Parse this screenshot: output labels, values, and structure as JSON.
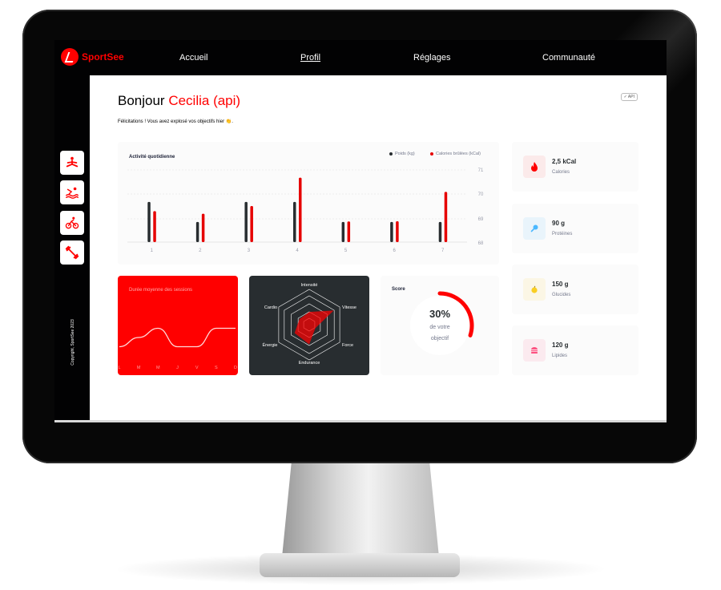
{
  "app": {
    "logo_text": "SportSee",
    "nav": [
      "Accueil",
      "Profil",
      "Réglages",
      "Communauté"
    ],
    "copyright": "Copyright, SportSee 2023"
  },
  "sidebar": {
    "icons": [
      "yoga-icon",
      "swimming-icon",
      "cycling-icon",
      "dumbbell-icon"
    ]
  },
  "profile": {
    "greeting": "Bonjour ",
    "name": "Cecilia (api)",
    "message": "Félicitations ! Vous avez explosé vos objectifs hier 👏.",
    "api_badge": "✓ API"
  },
  "activity": {
    "title": "Activité quotidienne",
    "legend_weight": "Poids (kg)",
    "legend_calories": "Calories brûlées (kCal)",
    "colors": {
      "weight": "#282d30",
      "calories": "#e60000"
    },
    "chart_data": {
      "type": "bar",
      "categories": [
        "1",
        "2",
        "3",
        "4",
        "5",
        "6",
        "7"
      ],
      "series": [
        {
          "name": "Poids (kg)",
          "values": [
            70,
            69,
            70,
            70,
            69,
            69,
            69
          ]
        },
        {
          "name": "Calories brûlées (kCal)",
          "values": [
            240,
            220,
            280,
            500,
            160,
            162,
            390
          ]
        }
      ],
      "y_ticks": [
        "71",
        "70",
        "69",
        "68"
      ],
      "ylim": [
        68,
        71
      ]
    }
  },
  "sessions": {
    "title": "Durée moyenne des sessions",
    "chart_data": {
      "type": "line",
      "categories": [
        "L",
        "M",
        "M",
        "J",
        "V",
        "S",
        "D"
      ],
      "values": [
        30,
        40,
        50,
        30,
        30,
        50,
        50
      ]
    }
  },
  "performance": {
    "chart_data": {
      "type": "radar",
      "axes": [
        "Intensité",
        "Vitesse",
        "Force",
        "Endurance",
        "Énergie",
        "Cardio"
      ],
      "values": [
        90,
        200,
        50,
        140,
        120,
        80
      ],
      "max": 250
    }
  },
  "score": {
    "title": "Score",
    "percent_label": "30%",
    "line1": "de votre",
    "line2": "objectif",
    "value": 0.3
  },
  "key_data": [
    {
      "value": "2,5 kCal",
      "label": "Calories",
      "icon": "fire-icon",
      "bg": "#fbeaea",
      "fg": "#ff0000"
    },
    {
      "value": "90 g",
      "label": "Protéines",
      "icon": "drumstick-icon",
      "bg": "#e9f4fb",
      "fg": "#4ab8ff"
    },
    {
      "value": "150 g",
      "label": "Glucides",
      "icon": "apple-icon",
      "bg": "#fbf6e5",
      "fg": "#f9ce23"
    },
    {
      "value": "120 g",
      "label": "Lipides",
      "icon": "burger-icon",
      "bg": "#fbeaef",
      "fg": "#fd5181"
    }
  ]
}
